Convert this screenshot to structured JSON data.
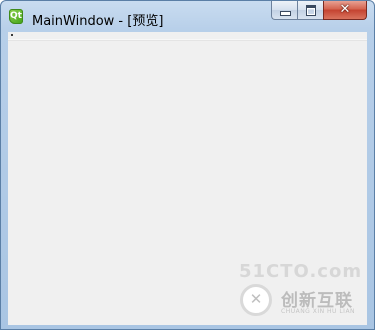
{
  "window": {
    "title": "MainWindow - [预览]",
    "app_icon": "qt-designer-icon",
    "icon_glyph": "Qt",
    "frame_color": "#a9c5e3"
  },
  "caption_buttons": {
    "minimize": "minimize-icon",
    "maximize": "maximize-icon",
    "close": "close-icon",
    "close_glyph": "✕",
    "close_color": "#c44330"
  },
  "watermark": {
    "top_text": "51CTO.com",
    "logo_icon": "chuangxin-hulian-logo-icon",
    "logo_glyph": "✕",
    "brand_name": "创新互联",
    "brand_sub": "CHUANG XIN HU LIAN"
  }
}
